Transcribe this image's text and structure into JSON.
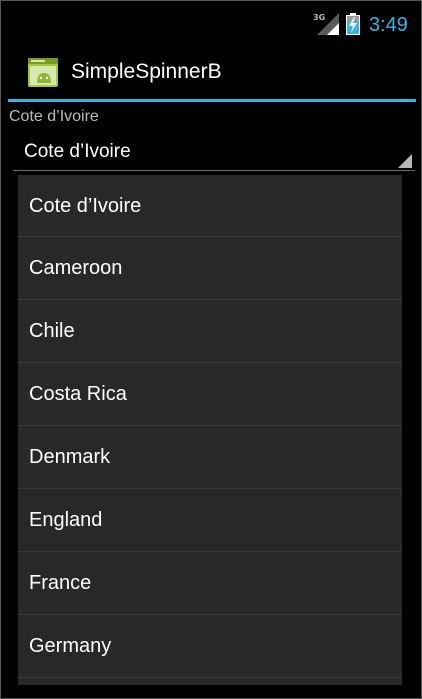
{
  "status_bar": {
    "network_label": "3G",
    "time": "3:49",
    "accent_color": "#33b5e5"
  },
  "action_bar": {
    "title": "SimpleSpinnerB",
    "icon": "android-app-icon"
  },
  "content": {
    "selected_label": "Cote d’Ivoire",
    "spinner_value": "Cote d’Ivoire"
  },
  "dropdown": {
    "items": [
      {
        "label": "Cote d’Ivoire"
      },
      {
        "label": "Cameroon"
      },
      {
        "label": "Chile"
      },
      {
        "label": "Costa Rica"
      },
      {
        "label": "Denmark"
      },
      {
        "label": "England"
      },
      {
        "label": "France"
      },
      {
        "label": "Germany"
      }
    ]
  }
}
